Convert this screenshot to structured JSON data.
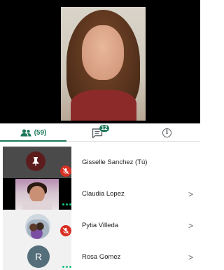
{
  "tabs": {
    "people_count": "(59)",
    "chat_badge": "12"
  },
  "participants": [
    {
      "name": "Gisselle Sanchez (Tú)",
      "tile": "pin",
      "muted": true,
      "chevron": ""
    },
    {
      "name": "Claudia Lopez",
      "tile": "video",
      "muted": false,
      "chevron": ">"
    },
    {
      "name": "Pytia Villeda",
      "tile": "photo",
      "muted": true,
      "chevron": ">"
    },
    {
      "name": "Rosa Gomez",
      "tile": "letter",
      "avatar_letter": "R",
      "muted": false,
      "chevron": ">"
    }
  ],
  "colors": {
    "accent": "#1e7a5b",
    "muted_red": "#d93025",
    "speaking_green": "#19c37d"
  },
  "icons": {
    "people_tab": "people-icon",
    "chat_tab": "chat-icon",
    "info_tab": "info-icon",
    "pin": "pin-icon",
    "mic_off": "mic-off-icon"
  }
}
